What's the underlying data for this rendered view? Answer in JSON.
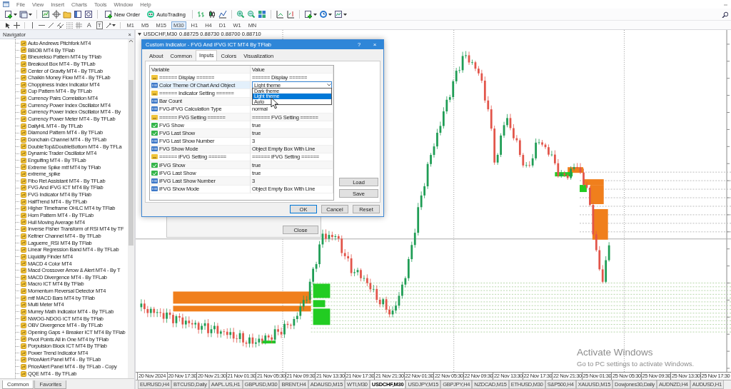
{
  "menu": [
    "File",
    "View",
    "Insert",
    "Charts",
    "Tools",
    "Window",
    "Help"
  ],
  "toolbar": {
    "new_order": "New Order",
    "auto_trading": "AutoTrading"
  },
  "drawing_toolbar": {
    "text_tool": "A",
    "label_tool": "T",
    "timeframes": [
      {
        "label": "M1",
        "selected": false
      },
      {
        "label": "M5",
        "selected": false
      },
      {
        "label": "M15",
        "selected": false
      },
      {
        "label": "M30",
        "selected": true
      },
      {
        "label": "H1",
        "selected": false
      },
      {
        "label": "H4",
        "selected": false
      },
      {
        "label": "D1",
        "selected": false
      },
      {
        "label": "W1",
        "selected": false
      },
      {
        "label": "MN",
        "selected": false
      }
    ]
  },
  "navigator": {
    "title": "Navigator",
    "close": "×",
    "items": [
      "Auto Andrews Pitchfork MT4",
      "BBOB MT4 By TFlab",
      "Bheurekso Pattern MT4 by TFlab",
      "Breakout Box MT4 - By TFLab",
      "Center of Gravity MT4 - By TFLab",
      "Chaikin Money Flow MT4 - By TFLab",
      "Choppiness Index Indicator MT4",
      "Cup Pattern MT4 - By TFLab",
      "Currency Pairs Correlation MT4",
      "Currency Power Index Oscillator MT4",
      "Currency Power Index Oscillator MT4 - By",
      "Currency Power Meter MT4 - By TFLab",
      "DailyHL MT4 - By TFLab",
      "Diamond Pattern MT4 - By TFLab",
      "Donchain Channel MT4 - By TFLab",
      "DoubleTop&DoubleBottom MT4 - By TFLa",
      "Dynamic Trader Oscillator MT4",
      "Engulfing MT4 - By TFLab",
      "Extreme Spike mtf MT4 by TFlab",
      "extreme_spike",
      "Fibo Ret Assistant MT4 - By TFLab",
      "FVG And iFVG ICT MT4 By TFlab",
      "FVG Indicator MT4 By TFlab",
      "HalfTrend MT4 - By TFLab",
      "Higher Timeframe OHLC MT4 by TFlab",
      "Horn Pattern MT4 - By TFLab",
      "Hull Moving Average MT4",
      "Inverse Fisher Transform of RSI MT4 by TF",
      "Keltner Channel MT4 - By TFLab",
      "Laguerre_RSI MT4 By TFlab",
      "Linear Regression Band MT4 - By TFLab",
      "Liquidity Finder MT4",
      "MACD 4 Color MT4",
      "Macd Crossover Arrow & Alert MT4 - By T",
      "MACD Divergence MT4 - By TFLab",
      "Macro ICT MT4 By TFlab",
      "Momentum Reversal Detector MT4",
      "mtf MACD Bars MT4 by TFlab",
      "Multi Meter MT4",
      "Murrey Math Indicator MT4 - By TFLab",
      "NWOG-NDOG ICT MT4 By TFlab",
      "OBV Divergence MT4 - By TFLab",
      "Opening Gaps + Breaker ICT MT4 By TFlab",
      "Pivot Points All in One MT4 by TFlab",
      "Porpulsion Block ICT MT4 By TFlab",
      "Power Trend Indicator MT4",
      "PriceAlert Panel MT4 - By TFLab",
      "PriceAlert Panel MT4 - By TFLab - Copy",
      "QQE MT4 - By TFLab"
    ],
    "tabs": [
      {
        "label": "Common",
        "selected": true
      },
      {
        "label": "Favorites",
        "selected": false
      }
    ]
  },
  "chart": {
    "symbol": "USDCHF,M30",
    "quote": "0.88725 0.88730 0.88700 0.88710",
    "time_labels": [
      "20 Nov 2024",
      "20 Nov 17:30",
      "20 Nov 21:30",
      "21 Nov 01:30",
      "21 Nov 05:30",
      "21 Nov 09:30",
      "21 Nov 13:30",
      "21 Nov 17:30",
      "21 Nov 21:30",
      "22 Nov 01:30",
      "22 Nov 05:30",
      "22 Nov 09:30",
      "22 Nov 13:30",
      "22 Nov 17:30",
      "22 Nov 21:30",
      "25 Nov 01:30",
      "25 Nov 05:30",
      "25 Nov 09:30",
      "25 Nov 13:30",
      "25 Nov 17:30"
    ],
    "symbol_tabs": [
      {
        "label": "EURUSD,H4",
        "selected": false
      },
      {
        "label": "BTCUSD,Daily",
        "selected": false
      },
      {
        "label": "AAPL.US,H1",
        "selected": false
      },
      {
        "label": "GBPUSD,M30",
        "selected": false
      },
      {
        "label": "BRENT,H4",
        "selected": false
      },
      {
        "label": "ADAUSD,M15",
        "selected": false
      },
      {
        "label": "WTI,M30",
        "selected": false
      },
      {
        "label": "USDCHF,M30",
        "selected": true
      },
      {
        "label": "USDJPY,M15",
        "selected": false
      },
      {
        "label": "GBPJPY,H4",
        "selected": false
      },
      {
        "label": "NZDCAD,M15",
        "selected": false
      },
      {
        "label": "ETHUSD,M30",
        "selected": false
      },
      {
        "label": "S&P500,H4",
        "selected": false
      },
      {
        "label": "XAUUSD,M15",
        "selected": false
      },
      {
        "label": "Dowjones30,Daily",
        "selected": false
      },
      {
        "label": "AUDNZD,H4",
        "selected": false
      },
      {
        "label": "AUDUSD,H1",
        "selected": false
      }
    ]
  },
  "dialog": {
    "title": "Custom Indicator - FVG And iFVG ICT MT4 By TFlab",
    "help": "?",
    "close": "×",
    "tabs": [
      {
        "label": "About",
        "selected": false
      },
      {
        "label": "Common",
        "selected": false
      },
      {
        "label": "Inputs",
        "selected": true
      },
      {
        "label": "Colors",
        "selected": false
      },
      {
        "label": "Visualization",
        "selected": false
      }
    ],
    "columns": [
      "Variable",
      "Value"
    ],
    "rows": [
      {
        "kind": "string",
        "variable": "====== Display ======",
        "value": "====== Display ======",
        "selected": false
      },
      {
        "kind": "enum",
        "variable": "Color Theme Of Chart And Object",
        "value": "Light theme",
        "selected": true,
        "open": true,
        "options": [
          {
            "label": "Dark theme",
            "selected": false
          },
          {
            "label": "Light theme",
            "selected": true
          },
          {
            "label": "Auto",
            "selected": false
          }
        ]
      },
      {
        "kind": "string",
        "variable": "====== Indicator Setting ======",
        "selected": false
      },
      {
        "kind": "int",
        "variable": "Bar Count",
        "selected": false
      },
      {
        "kind": "enum",
        "variable": "FVG-iFVG Calculation Type",
        "value": "normal",
        "selected": false
      },
      {
        "kind": "string",
        "variable": "====== FVG Setting ======",
        "value": "====== FVG Setting ======",
        "selected": false
      },
      {
        "kind": "bool",
        "variable": "FVG Show",
        "value": "true",
        "selected": false
      },
      {
        "kind": "bool",
        "variable": "FVG Last Show",
        "value": "true",
        "selected": false
      },
      {
        "kind": "int",
        "variable": "FVG Last Show Number",
        "value": "3",
        "selected": false
      },
      {
        "kind": "enum",
        "variable": "FVG Show Mode",
        "value": "Object Empty Box With Line",
        "selected": false
      },
      {
        "kind": "string",
        "variable": "====== iFVG Setting ======",
        "value": "====== iFVG Setting ======",
        "selected": false
      },
      {
        "kind": "bool",
        "variable": "iFVG Show",
        "value": "true",
        "selected": false
      },
      {
        "kind": "bool",
        "variable": "iFVG Last Show",
        "value": "true",
        "selected": false
      },
      {
        "kind": "int",
        "variable": "iFVG Last Show Number",
        "value": "3",
        "selected": false
      },
      {
        "kind": "enum",
        "variable": "iFVG Show Mode",
        "value": "Object Empty Box With Line",
        "selected": false
      }
    ],
    "side_buttons": [
      "Load",
      "Save"
    ],
    "buttons": [
      "OK",
      "Cancel",
      "Reset"
    ]
  },
  "background_window": {
    "button": "Close"
  },
  "activation": {
    "title": "Activate Windows",
    "message": "Go to PC settings to activate Windows."
  }
}
